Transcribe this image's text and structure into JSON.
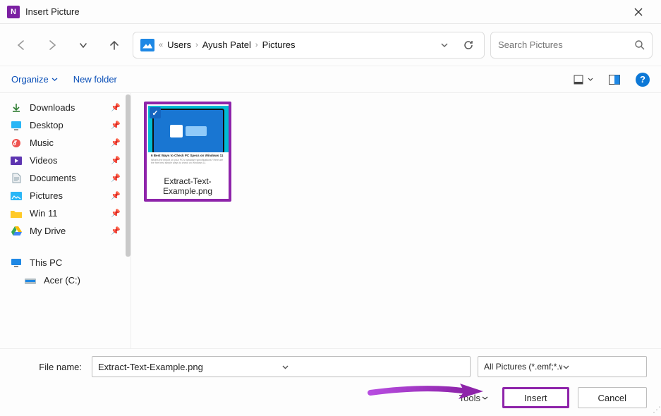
{
  "window": {
    "title": "Insert Picture"
  },
  "breadcrumb": {
    "overflow": "«",
    "items": [
      "Users",
      "Ayush Patel",
      "Pictures"
    ]
  },
  "search": {
    "placeholder": "Search Pictures"
  },
  "toolbar": {
    "organize": "Organize",
    "newfolder": "New folder"
  },
  "sidebar": {
    "items": [
      {
        "icon": "downloads",
        "label": "Downloads",
        "pinned": true
      },
      {
        "icon": "desktop",
        "label": "Desktop",
        "pinned": true
      },
      {
        "icon": "music",
        "label": "Music",
        "pinned": true
      },
      {
        "icon": "videos",
        "label": "Videos",
        "pinned": true
      },
      {
        "icon": "documents",
        "label": "Documents",
        "pinned": true
      },
      {
        "icon": "pictures",
        "label": "Pictures",
        "pinned": true
      },
      {
        "icon": "folder",
        "label": "Win 11",
        "pinned": true
      },
      {
        "icon": "drive",
        "label": "My Drive",
        "pinned": true
      }
    ],
    "thispc": "This PC",
    "acer": "Acer (C:)"
  },
  "file": {
    "label": "Extract-Text-Example.png",
    "preview_headline": "6 Best Ways to Check PC Specs on Windows 11",
    "preview_sub": "What's the import on your PC's hardware specifications? Here are the five best simple ways to check on Windows 11"
  },
  "footer": {
    "filename_label": "File name:",
    "filename_value": "Extract-Text-Example.png",
    "filetype": "All Pictures (*.emf;*.wmf;*.jpg;*.j",
    "tools": "Tools",
    "insert": "Insert",
    "cancel": "Cancel"
  }
}
